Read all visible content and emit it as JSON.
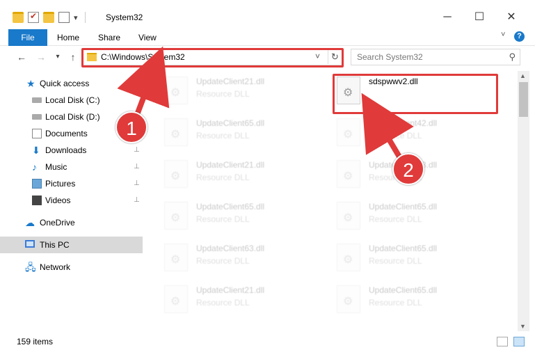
{
  "window": {
    "title": "System32",
    "minimize_glyph": "─",
    "maximize_glyph": "☐",
    "close_glyph": "✕",
    "qat_dropdown_glyph": "▾"
  },
  "ribbon": {
    "tabs": [
      "File",
      "Home",
      "Share",
      "View"
    ],
    "expand_glyph": "˅",
    "help_glyph": "?"
  },
  "nav": {
    "back_glyph": "←",
    "forward_glyph": "→",
    "recent_glyph": "▾",
    "up_glyph": "↑",
    "address": "C:\\Windows\\System32",
    "address_dropdown_glyph": "˅",
    "refresh_glyph": "↻",
    "search_placeholder": "Search System32",
    "search_glyph": "⚲"
  },
  "sidebar": {
    "items": [
      {
        "label": "Quick access",
        "icon": "star-icon",
        "pinned": false
      },
      {
        "label": "Local Disk (C:)",
        "icon": "disk-icon",
        "pinned": false
      },
      {
        "label": "Local Disk (D:)",
        "icon": "disk-icon",
        "pinned": false
      },
      {
        "label": "Documents",
        "icon": "documents-icon",
        "pinned": false
      },
      {
        "label": "Downloads",
        "icon": "downloads-icon",
        "pinned": true
      },
      {
        "label": "Music",
        "icon": "music-icon",
        "pinned": true
      },
      {
        "label": "Pictures",
        "icon": "pictures-icon",
        "pinned": true
      },
      {
        "label": "Videos",
        "icon": "videos-icon",
        "pinned": true
      },
      {
        "label": "OneDrive",
        "icon": "onedrive-icon",
        "pinned": false
      },
      {
        "label": "This PC",
        "icon": "this-pc-icon",
        "pinned": false,
        "selected": true
      },
      {
        "label": "Network",
        "icon": "network-icon",
        "pinned": false
      }
    ],
    "pin_glyph": "📌"
  },
  "files": {
    "highlighted": {
      "name": "sdspwwv2.dll",
      "type": ""
    },
    "left_column": [
      {
        "name": "UpdateClient21.dll",
        "type": "Resource DLL"
      },
      {
        "name": "UpdateClient65.dll",
        "type": "Resource DLL"
      },
      {
        "name": "UpdateClient21.dll",
        "type": "Resource DLL"
      },
      {
        "name": "UpdateClient65.dll",
        "type": "Resource DLL"
      },
      {
        "name": "UpdateClient63.dll",
        "type": "Resource DLL"
      },
      {
        "name": "UpdateClient21.dll",
        "type": "Resource DLL"
      }
    ],
    "right_column": [
      {
        "name": "UpdateClient42.dll",
        "type": "Resource DLL"
      },
      {
        "name": "UpdateClient63.dll",
        "type": "Resource DLL"
      },
      {
        "name": "UpdateClient65.dll",
        "type": "Resource DLL"
      },
      {
        "name": "UpdateClient65.dll",
        "type": "Resource DLL"
      },
      {
        "name": "UpdateClient65.dll",
        "type": "Resource DLL"
      }
    ]
  },
  "status": {
    "item_count": "159 items"
  },
  "annotations": {
    "step1": "1",
    "step2": "2",
    "accent_color": "#e03a3a"
  }
}
